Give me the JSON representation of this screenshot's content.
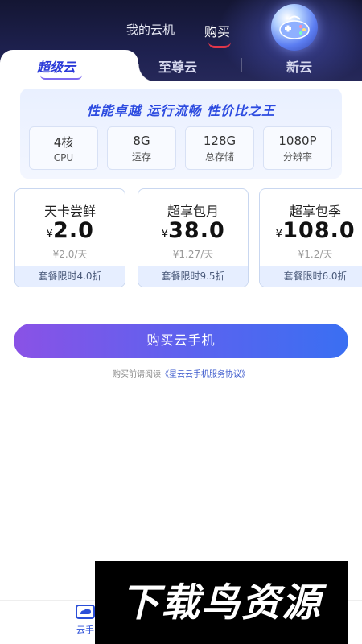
{
  "header": {
    "tabs": [
      {
        "label": "我的云机",
        "active": false
      },
      {
        "label": "购买",
        "active": true
      }
    ],
    "accent_color": "#e0364a"
  },
  "product_tabs": [
    {
      "label": "超级云",
      "active": true
    },
    {
      "label": "至尊云",
      "active": false
    },
    {
      "label": "新云",
      "active": false
    }
  ],
  "feature": {
    "title": "性能卓越 运行流畅 性价比之王",
    "specs": [
      {
        "value": "4核",
        "label": "CPU"
      },
      {
        "value": "8G",
        "label": "运存"
      },
      {
        "value": "128G",
        "label": "总存储"
      },
      {
        "value": "1080P",
        "label": "分辨率"
      }
    ]
  },
  "plans": [
    {
      "name": "天卡尝鲜",
      "currency": "¥",
      "price": "2.0",
      "unit_price": "¥2.0/天",
      "discount": "套餐限时4.0折"
    },
    {
      "name": "超享包月",
      "currency": "¥",
      "price": "38.0",
      "unit_price": "¥1.27/天",
      "discount": "套餐限时9.5折"
    },
    {
      "name": "超享包季",
      "currency": "¥",
      "price": "108.0",
      "unit_price": "¥1.2/天",
      "discount": "套餐限时6.0折"
    }
  ],
  "buy_button": {
    "label": "购买云手机"
  },
  "agreement": {
    "prefix": "购买前请阅读",
    "link": "《星云云手机服务协议》"
  },
  "bottom_nav": [
    {
      "label": "云手",
      "icon": "cloud-phone-icon",
      "active": true
    }
  ],
  "watermark": {
    "text": "下载鸟资源"
  }
}
